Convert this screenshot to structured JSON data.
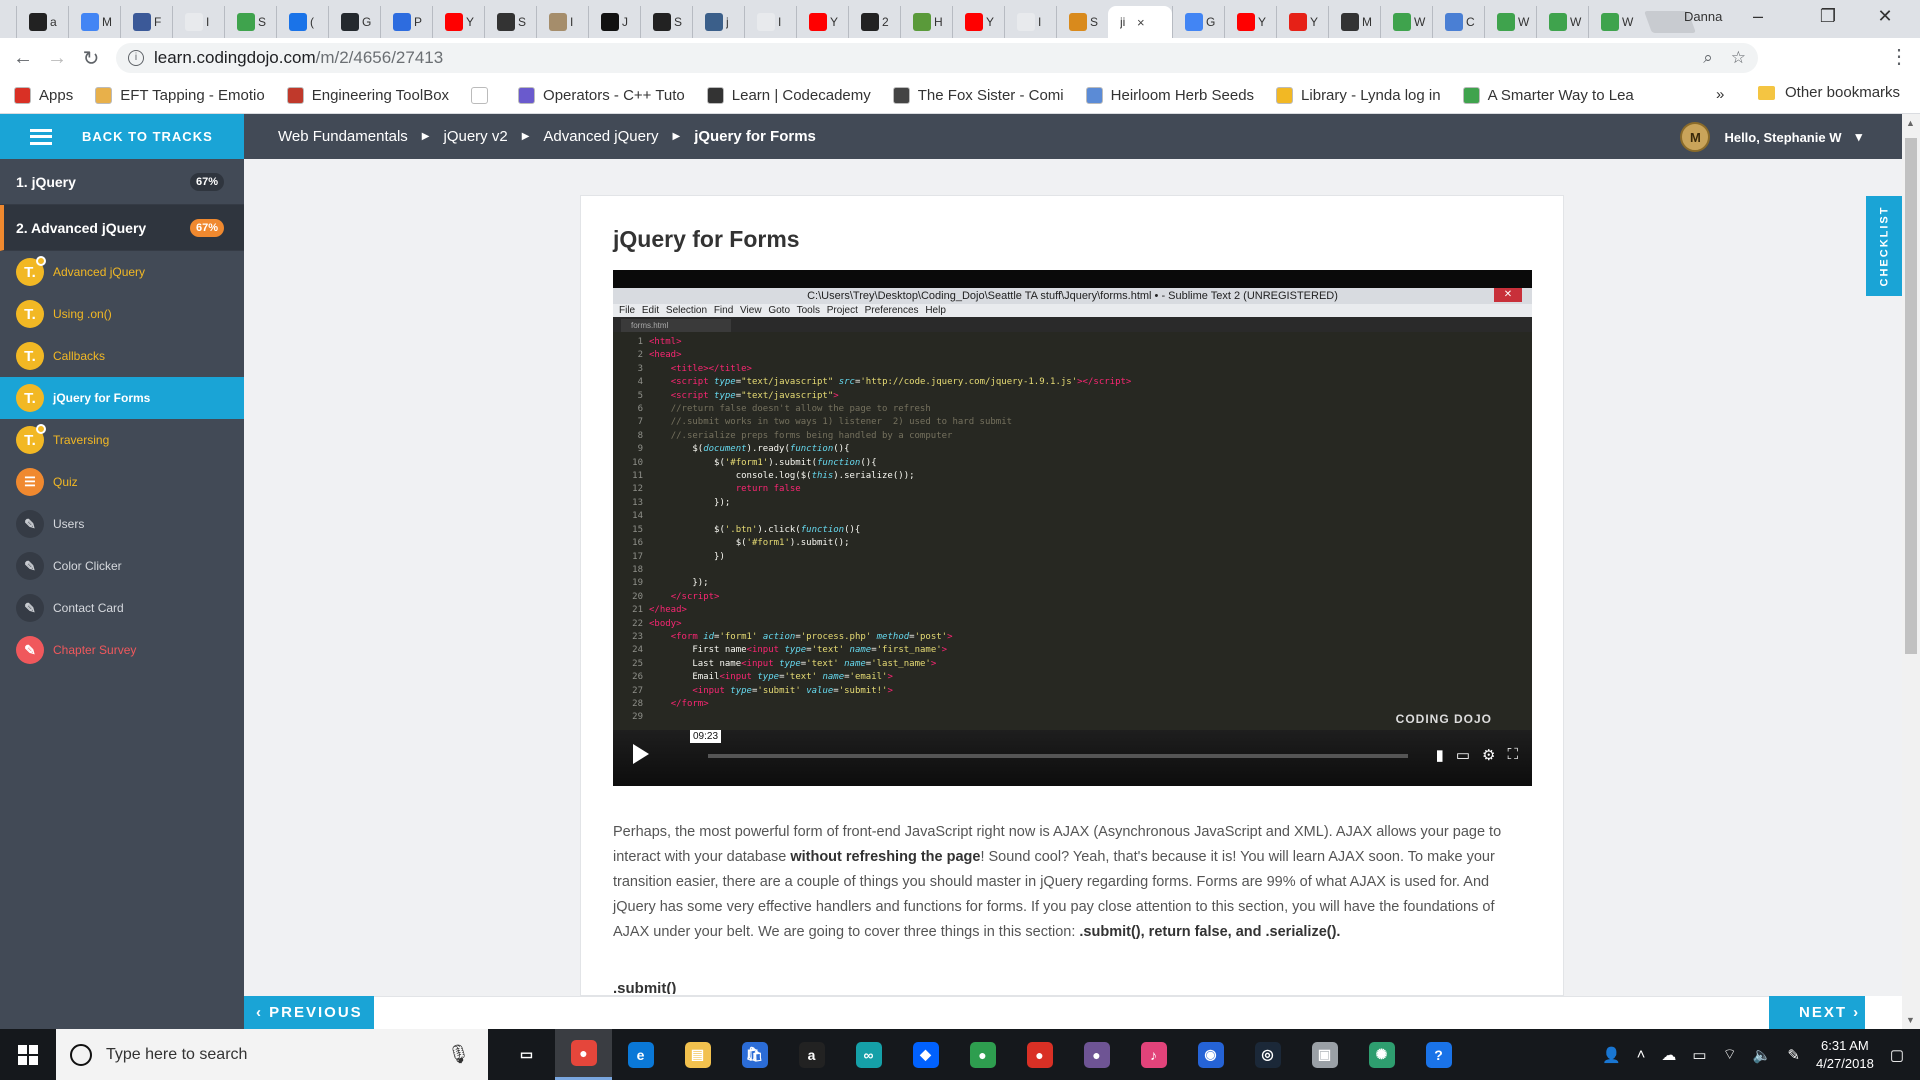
{
  "browser": {
    "tabs": [
      {
        "title": "a",
        "color": "#222222"
      },
      {
        "title": "M",
        "color": "#4285f4"
      },
      {
        "title": "F",
        "color": "#3b5998"
      },
      {
        "title": "I",
        "color": "#e8eaed"
      },
      {
        "title": "S",
        "color": "#3fa34d"
      },
      {
        "title": "(",
        "color": "#1a73e8"
      },
      {
        "title": "G",
        "color": "#24292e"
      },
      {
        "title": "P",
        "color": "#2d6cdf"
      },
      {
        "title": "Y",
        "color": "#ff0000"
      },
      {
        "title": "S",
        "color": "#333333"
      },
      {
        "title": "I",
        "color": "#a58d6b"
      },
      {
        "title": "J",
        "color": "#111111"
      },
      {
        "title": "S",
        "color": "#222222"
      },
      {
        "title": "j",
        "color": "#3b5f8a"
      },
      {
        "title": "I",
        "color": "#e8eaed"
      },
      {
        "title": "Y",
        "color": "#ff0000"
      },
      {
        "title": "2",
        "color": "#222222"
      },
      {
        "title": "H",
        "color": "#5a9a3a"
      },
      {
        "title": "Y",
        "color": "#ff0000"
      },
      {
        "title": "I",
        "color": "#e8eaed"
      },
      {
        "title": "S",
        "color": "#d98a1c"
      }
    ],
    "active_tab": {
      "title": "ji",
      "close": "×"
    },
    "tabs_after": [
      {
        "title": "G",
        "color": "#4285f4"
      },
      {
        "title": "Y",
        "color": "#ff0000"
      },
      {
        "title": "Y",
        "color": "#e62117"
      },
      {
        "title": "M",
        "color": "#333333"
      },
      {
        "title": "W",
        "color": "#3fa34d"
      },
      {
        "title": "C",
        "color": "#4a7fd4"
      },
      {
        "title": "W",
        "color": "#3fa34d"
      },
      {
        "title": "W",
        "color": "#3fa34d"
      },
      {
        "title": "W",
        "color": "#3fa34d"
      }
    ],
    "profile_name": "Danna",
    "url_host": "learn.codingdojo.com",
    "url_path": "/m/2/4656/27413",
    "bookmarks": [
      {
        "label": "Apps",
        "color": "#d93025"
      },
      {
        "label": "EFT Tapping - Emotio",
        "color": "#e8b04a"
      },
      {
        "label": "Engineering ToolBox",
        "color": "#c0392b"
      },
      {
        "label": "",
        "color": "#ffffff"
      },
      {
        "label": "Operators - C++ Tuto",
        "color": "#6a5acd"
      },
      {
        "label": "Learn | Codecademy",
        "color": "#333333"
      },
      {
        "label": "The Fox Sister - Comi",
        "color": "#444444"
      },
      {
        "label": "Heirloom Herb Seeds",
        "color": "#5b8bd6"
      },
      {
        "label": "Library - Lynda log in",
        "color": "#f2b824"
      },
      {
        "label": "A Smarter Way to Lea",
        "color": "#3fa34d"
      }
    ],
    "bookmarks_more": "»",
    "other_bookmarks": "Other bookmarks"
  },
  "sidebar": {
    "back_label": "BACK TO TRACKS",
    "tracks": [
      {
        "label": "1. jQuery",
        "pct": "67%"
      },
      {
        "label": "2. Advanced jQuery",
        "pct": "67%"
      }
    ],
    "lessons": [
      {
        "label": "Advanced jQuery",
        "icon": "T.",
        "style": "yellow",
        "dot": true
      },
      {
        "label": "Using .on()",
        "icon": "T.",
        "style": "yellow",
        "dot": false
      },
      {
        "label": "Callbacks",
        "icon": "T.",
        "style": "yellow",
        "dot": false
      },
      {
        "label": "jQuery for Forms",
        "icon": "T.",
        "style": "yellow",
        "dot": false,
        "active": true
      },
      {
        "label": "Traversing",
        "icon": "T.",
        "style": "yellow",
        "dot": true
      },
      {
        "label": "Quiz",
        "icon": "☰",
        "style": "orange",
        "dot": false
      },
      {
        "label": "Users",
        "icon": "✎",
        "style": "dark",
        "dot": false
      },
      {
        "label": "Color Clicker",
        "icon": "✎",
        "style": "dark",
        "dot": false
      },
      {
        "label": "Contact Card",
        "icon": "✎",
        "style": "dark",
        "dot": false
      },
      {
        "label": "Chapter Survey",
        "icon": "✎",
        "style": "red",
        "dot": false
      }
    ]
  },
  "header": {
    "breadcrumbs": [
      "Web Fundamentals",
      "jQuery v2",
      "Advanced jQuery",
      "jQuery for Forms"
    ],
    "user_greeting": "Hello, Stephanie W",
    "avatar_initial": "M"
  },
  "main": {
    "title": "jQuery for Forms",
    "video": {
      "window_title": "C:\\Users\\Trey\\Desktop\\Coding_Dojo\\Seattle TA stuff\\Jquery\\forms.html • - Sublime Text 2 (UNREGISTERED)",
      "menu": "File Edit Selection Find View Goto Tools Project Preferences Help",
      "file_tab": "forms.html",
      "timestamp": "09:23",
      "brand": "CODING DOJO",
      "progress": 0.0
    },
    "paragraph_1": "Perhaps, the most powerful form of front-end JavaScript right now is AJAX (Asynchronous JavaScript and XML). AJAX allows your page to interact with your database ",
    "paragraph_bold_1": "without refreshing the page",
    "paragraph_2": "! Sound cool? Yeah, that's because it is! You will learn AJAX soon. To make your transition easier, there are a couple of things you should master in jQuery regarding forms. Forms are 99% of what AJAX is used for. And jQuery has some very effective handlers and functions for forms. If you pay close attention to this section, you will have the foundations of AJAX under your belt. We are going to cover three things in this section: ",
    "paragraph_bold_2": ".submit(), return false, and .serialize().",
    "subheading": ".submit()"
  },
  "checklist_label": "CHECKLIST",
  "nav": {
    "previous": "‹  PREVIOUS",
    "next": "NEXT  ›"
  },
  "taskbar": {
    "search_placeholder": "Type here to search",
    "apps": [
      {
        "name": "task-view",
        "glyph": "▭",
        "color": "#15181c"
      },
      {
        "name": "chrome",
        "glyph": "●",
        "color": "#e5463b",
        "on": true
      },
      {
        "name": "edge",
        "glyph": "e",
        "color": "#0a78d7"
      },
      {
        "name": "file-explorer",
        "glyph": "▤",
        "color": "#f2c14e"
      },
      {
        "name": "store",
        "glyph": "🛍",
        "color": "#2b6cd6"
      },
      {
        "name": "amazon",
        "glyph": "a",
        "color": "#222222"
      },
      {
        "name": "arduino",
        "glyph": "∞",
        "color": "#15a0a8"
      },
      {
        "name": "dropbox",
        "glyph": "◆",
        "color": "#0061fe"
      },
      {
        "name": "app-green",
        "glyph": "●",
        "color": "#2e9e4f"
      },
      {
        "name": "app-red",
        "glyph": "●",
        "color": "#d93025"
      },
      {
        "name": "github",
        "glyph": "●",
        "color": "#6e5494"
      },
      {
        "name": "itunes",
        "glyph": "♪",
        "color": "#e2437a"
      },
      {
        "name": "app-blue",
        "glyph": "◉",
        "color": "#2563d6"
      },
      {
        "name": "steam",
        "glyph": "◎",
        "color": "#1b2838"
      },
      {
        "name": "app-gray",
        "glyph": "▣",
        "color": "#9aa0a6"
      },
      {
        "name": "app-teal",
        "glyph": "✺",
        "color": "#2e9e6f"
      },
      {
        "name": "help",
        "glyph": "?",
        "color": "#1a73e8"
      }
    ],
    "time": "6:31 AM",
    "date": "4/27/2018"
  }
}
